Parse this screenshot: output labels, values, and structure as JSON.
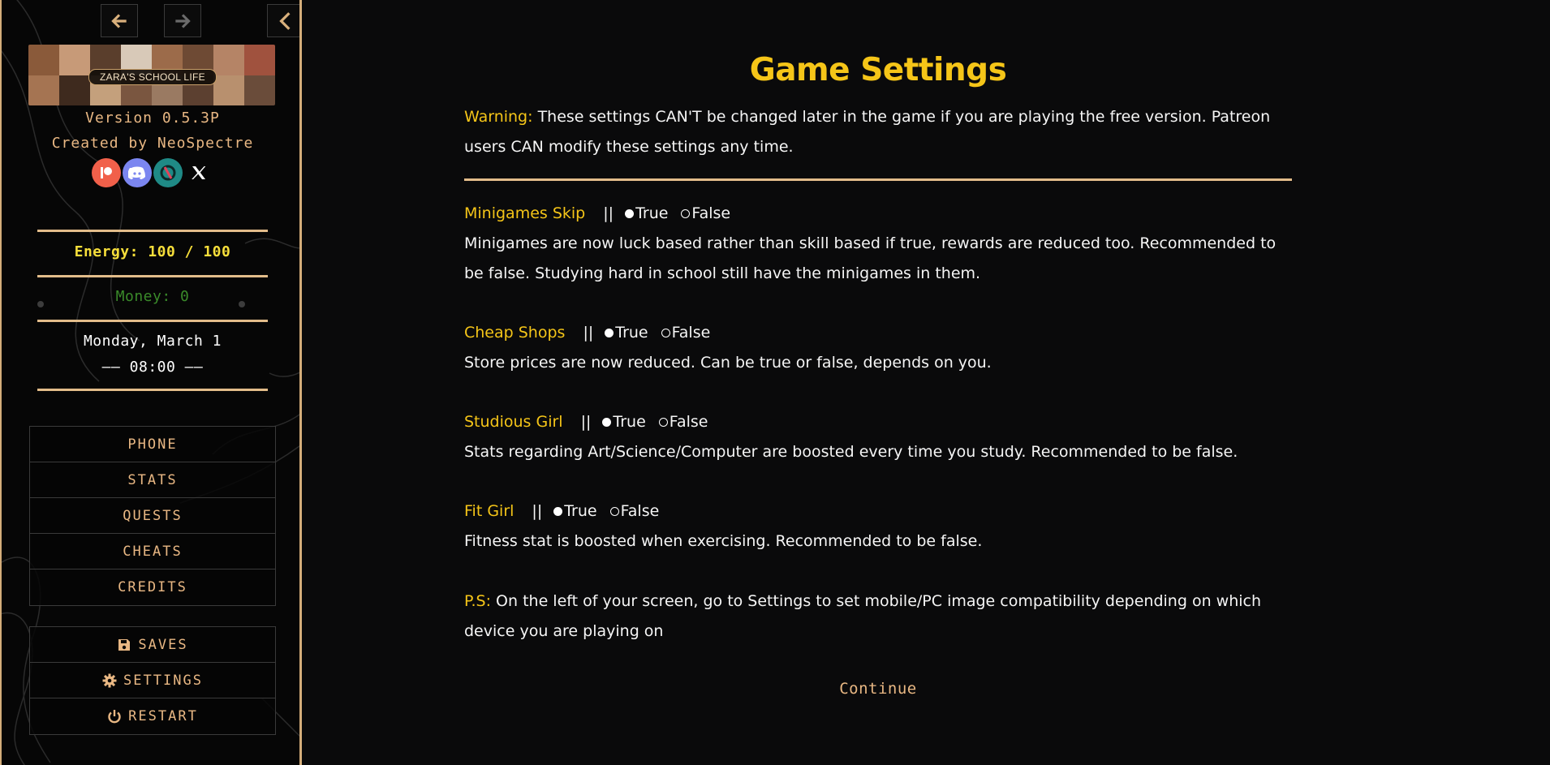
{
  "sidebar": {
    "nav": {
      "back_icon": "arrow-left-icon",
      "forward_icon": "arrow-right-icon",
      "collapse_icon": "chevron-left-icon"
    },
    "banner_text": "ZARA'S SCHOOL LIFE",
    "version": "Version 0.5.3P",
    "creator": "Created by NeoSpectre",
    "socials": [
      "patreon-icon",
      "discord-icon",
      "subscribestar-icon",
      "x-icon"
    ],
    "energy": "Energy: 100 / 100",
    "money": "Money: 0",
    "date": "Monday, March 1",
    "time": "—— 08:00 ——",
    "menu": [
      "PHONE",
      "STATS",
      "QUESTS",
      "CHEATS",
      "CREDITS"
    ],
    "system_menu": [
      {
        "label": "SAVES",
        "icon": "floppy-disk-icon"
      },
      {
        "label": "SETTINGS",
        "icon": "gear-icon"
      },
      {
        "label": "RESTART",
        "icon": "power-icon"
      }
    ]
  },
  "main": {
    "title": "Game Settings",
    "warning_label": "Warning:",
    "warning_text": " These settings CAN'T be changed later in the game if you are playing the free version. Patreon users CAN modify these settings any time.",
    "settings": [
      {
        "name": "Minigames Skip",
        "separator": "||",
        "true_label": "True",
        "false_label": "False",
        "selected": "True",
        "description": "Minigames are now luck based rather than skill based if true, rewards are reduced too. Recommended to be false. Studying hard in school still have the minigames in them."
      },
      {
        "name": "Cheap Shops",
        "separator": "||",
        "true_label": "True",
        "false_label": "False",
        "selected": "True",
        "description": "Store prices are now reduced. Can be true or false, depends on you."
      },
      {
        "name": "Studious Girl",
        "separator": "||",
        "true_label": "True",
        "false_label": "False",
        "selected": "True",
        "description": "Stats regarding Art/Science/Computer are boosted every time you study. Recommended to be false."
      },
      {
        "name": "Fit Girl",
        "separator": "||",
        "true_label": "True",
        "false_label": "False",
        "selected": "True",
        "description": "Fitness stat is boosted when exercising. Recommended to be false."
      }
    ],
    "ps_label": "P.S:",
    "ps_text": " On the left of your screen, go to Settings to set mobile/PC image compatibility depending on which device you are playing on",
    "continue_label": "Continue"
  },
  "colors": {
    "accent_gold": "#e2bc8a",
    "title_yellow": "#f5c518",
    "energy_yellow": "#f6de3a",
    "money_green": "#3a8a2a",
    "background": "#0a0a0b"
  }
}
